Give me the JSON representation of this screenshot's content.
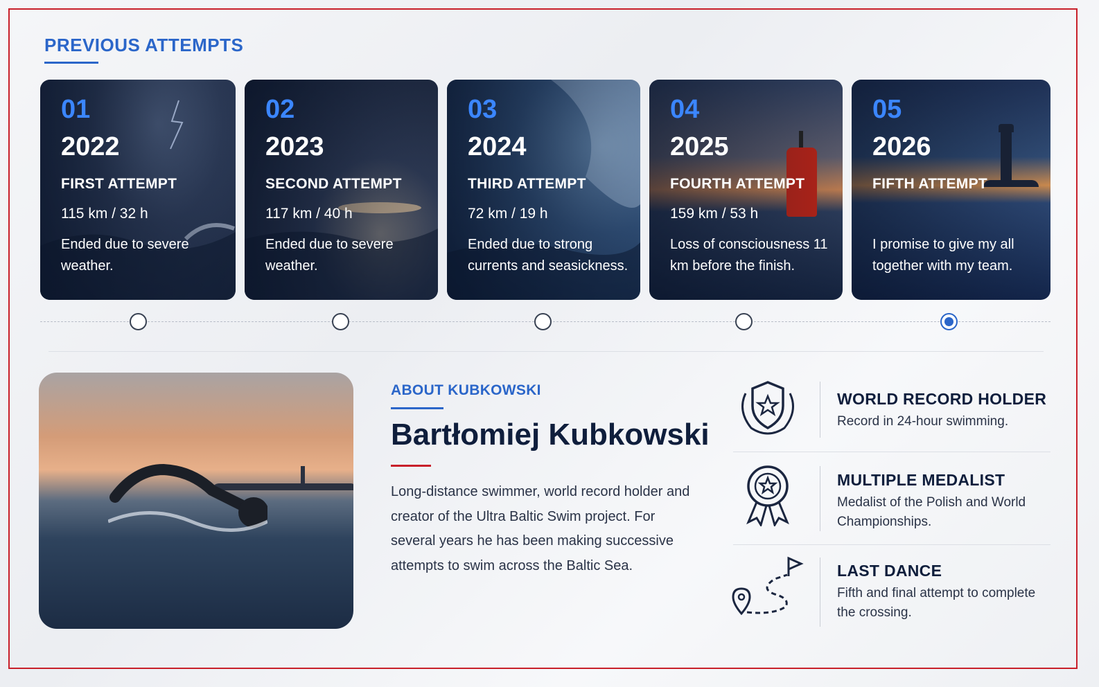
{
  "section": {
    "title": "PREVIOUS ATTEMPTS"
  },
  "attempts": [
    {
      "num": "01",
      "year": "2022",
      "label": "FIRST ATTEMPT",
      "stats": "115 km / 32 h",
      "desc": "Ended due to severe weather."
    },
    {
      "num": "02",
      "year": "2023",
      "label": "SECOND ATTEMPT",
      "stats": "117 km / 40 h",
      "desc": "Ended due to severe weather."
    },
    {
      "num": "03",
      "year": "2024",
      "label": "THIRD ATTEMPT",
      "stats": "72 km / 19 h",
      "desc": "Ended due to strong currents and seasickness."
    },
    {
      "num": "04",
      "year": "2025",
      "label": "FOURTH ATTEMPT",
      "stats": "159 km / 53 h",
      "desc": "Loss of consciousness 11 km before the finish."
    },
    {
      "num": "05",
      "year": "2026",
      "label": "FIFTH ATTEMPT",
      "stats": "",
      "desc": "I promise to give my all together with my team."
    }
  ],
  "timeline": {
    "selected_index": 4
  },
  "about": {
    "kicker": "ABOUT KUBKOWSKI",
    "name": "Bartłomiej Kubkowski",
    "text": "Long-distance swimmer, world record holder and creator of the Ultra Baltic Swim project. For several years he has been making successive attempts to swim across the Baltic Sea."
  },
  "features": [
    {
      "icon": "shield-laurel-icon",
      "title": "WORLD RECORD HOLDER",
      "desc": "Record in 24-hour swimming."
    },
    {
      "icon": "medal-icon",
      "title": "MULTIPLE MEDALIST",
      "desc": "Medalist of the Polish and World Championships."
    },
    {
      "icon": "route-flag-icon",
      "title": "LAST DANCE",
      "desc": "Fifth and final attempt to complete the crossing."
    }
  ],
  "colors": {
    "accent_blue": "#2b66c9",
    "accent_red": "#c8202a",
    "navy": "#0f1e3c"
  }
}
